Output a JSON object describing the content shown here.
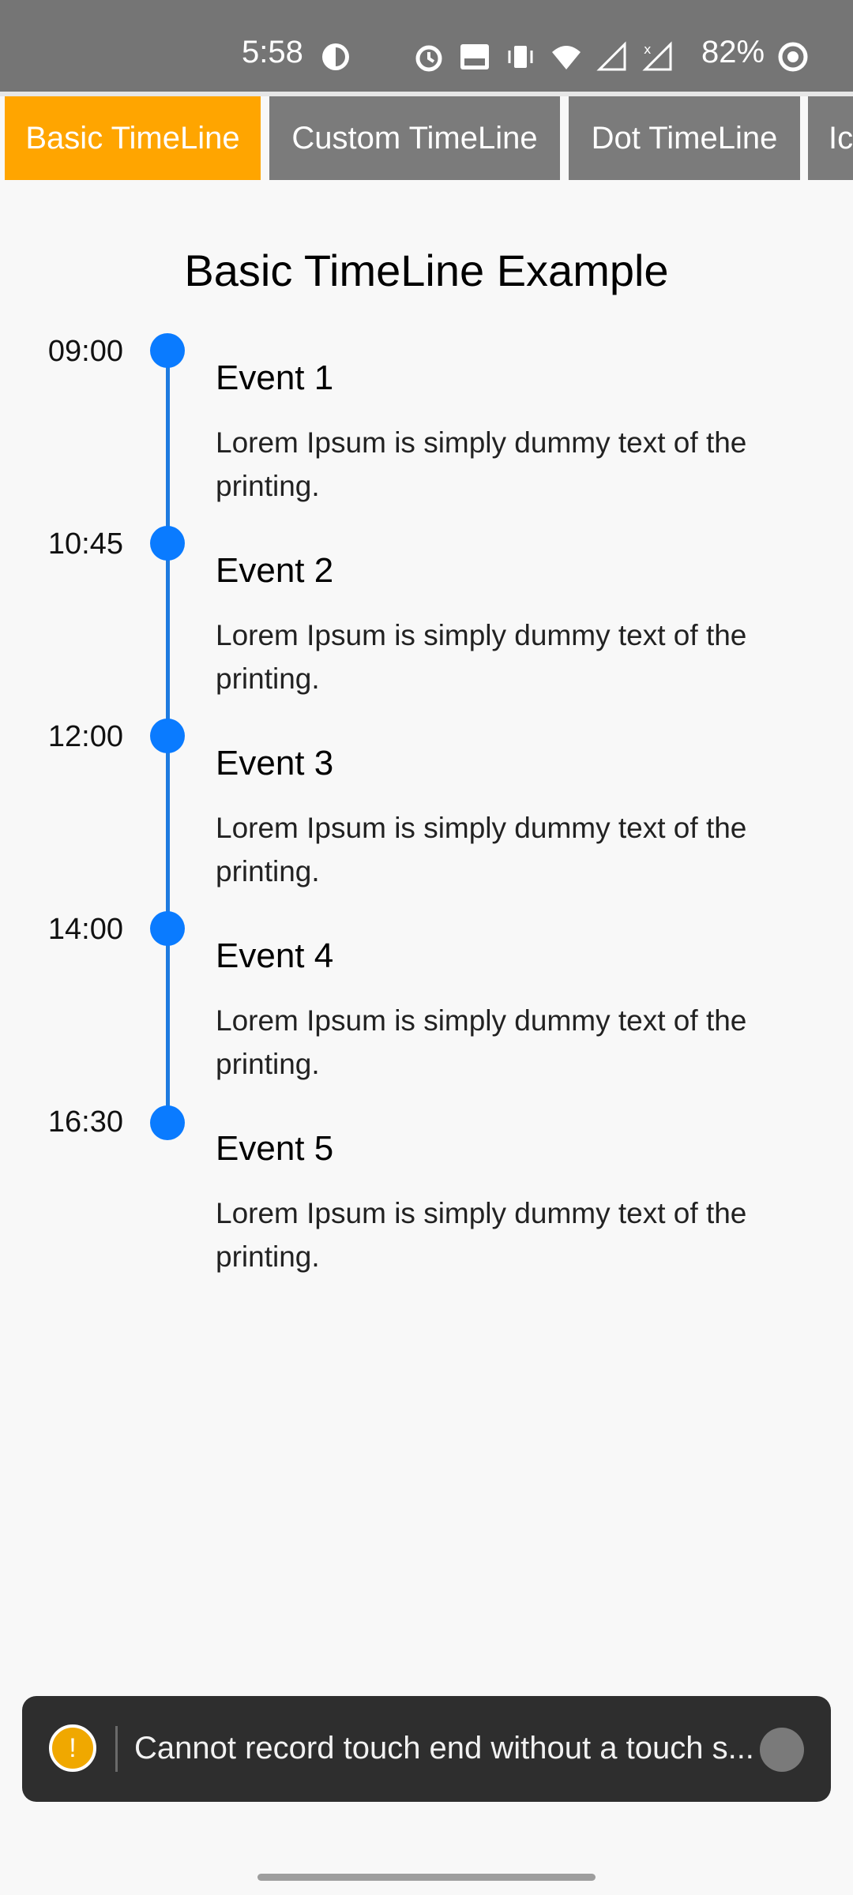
{
  "status_bar": {
    "time": "5:58",
    "battery": "82%",
    "icons": [
      "data-saver-icon",
      "alarm-icon",
      "volte-icon",
      "vibrate-icon",
      "wifi-icon",
      "signal-icon",
      "signal-x-icon",
      "battery-ring-icon"
    ]
  },
  "tabs": [
    {
      "label": "Basic TimeLine",
      "active": true
    },
    {
      "label": "Custom TimeLine",
      "active": false
    },
    {
      "label": "Dot TimeLine",
      "active": false
    },
    {
      "label": "Ic",
      "active": false
    }
  ],
  "page_title": "Basic TimeLine Example",
  "timeline": [
    {
      "time": "09:00",
      "title": "Event 1",
      "description": "Lorem Ipsum is simply dummy text of the printing."
    },
    {
      "time": "10:45",
      "title": "Event 2",
      "description": "Lorem Ipsum is simply dummy text of the printing."
    },
    {
      "time": "12:00",
      "title": "Event 3",
      "description": "Lorem Ipsum is simply dummy text of the printing."
    },
    {
      "time": "14:00",
      "title": "Event 4",
      "description": "Lorem Ipsum is simply dummy text of the printing."
    },
    {
      "time": "16:30",
      "title": "Event 5",
      "description": "Lorem Ipsum is simply dummy text of the printing."
    }
  ],
  "toast": {
    "icon": "warning-icon",
    "message": "Cannot record touch end without a touch s..."
  },
  "colors": {
    "status_bar": "#757575",
    "tab_active": "#ffa500",
    "tab_inactive": "#7b7b7b",
    "timeline_dot": "#0a7bff",
    "timeline_line": "#1e7be0",
    "toast_bg": "#2e2e2e"
  }
}
